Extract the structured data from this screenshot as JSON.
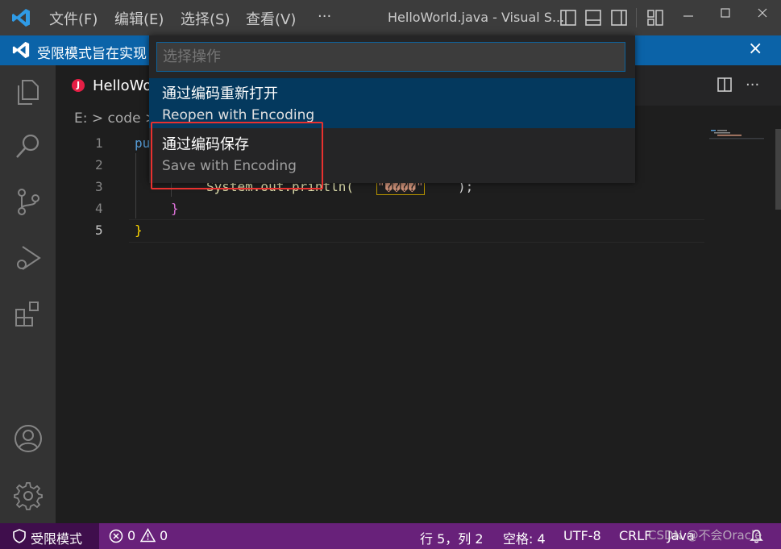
{
  "titlebar": {
    "menus": [
      "文件(F)",
      "编辑(E)",
      "选择(S)",
      "查看(V)",
      "···"
    ],
    "title": "HelloWorld.java - Visual S..."
  },
  "banner": {
    "text": "受限模式旨在实现",
    "close": "×"
  },
  "tab": {
    "icon_letter": "J",
    "label": "HelloWo"
  },
  "editor_actions": {
    "more": "···"
  },
  "breadcrumb": {
    "drive": "E:",
    "sep": ">",
    "folder": "code",
    "sep2": ">"
  },
  "line_numbers": [
    "1",
    "2",
    "3",
    "4",
    "5"
  ],
  "code": {
    "line1_fragment": "pu",
    "line3_call": "System.out.println(",
    "line3_string": "\"����\"",
    "line3_end": ");",
    "line4_brace": "}",
    "line5_brace": "}"
  },
  "quick_pick": {
    "placeholder": "选择操作",
    "items": [
      {
        "title": "通过编码重新打开",
        "subtitle": "Reopen with Encoding"
      },
      {
        "title": "通过编码保存",
        "subtitle": "Save with Encoding"
      }
    ]
  },
  "statusbar": {
    "restricted": "受限模式",
    "errors": "0",
    "warnings": "0",
    "position": "行 5，列 2",
    "spaces": "空格: 4",
    "encoding": "UTF-8",
    "eol": "CRLF",
    "language": "Java"
  },
  "watermark": "CSDN @不会Oracle",
  "colors": {
    "titlebar": "#3c3c3c",
    "banner": "#0b63a8",
    "statusbar": "#68217a",
    "accent": "#0e639c",
    "highlight_box": "#e8312f"
  },
  "icons": [
    "vscode-logo-icon",
    "layout-sidebar-icon",
    "layout-panel-icon",
    "layout-right-icon",
    "customize-layout-icon",
    "minimize-icon",
    "maximize-icon",
    "close-icon",
    "explorer-icon",
    "search-icon",
    "source-control-icon",
    "run-debug-icon",
    "extensions-icon",
    "account-icon",
    "settings-gear-icon",
    "split-editor-icon",
    "shield-icon",
    "error-icon",
    "warning-icon",
    "bell-icon"
  ]
}
